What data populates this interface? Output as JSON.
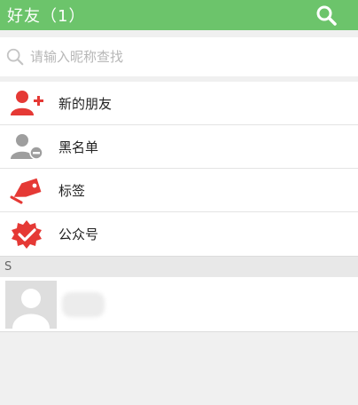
{
  "header": {
    "title": "好友（1）",
    "search_icon": "search-icon",
    "bg_color": "#6cc46b"
  },
  "search": {
    "placeholder": "请输入昵称查找",
    "icon": "search-icon"
  },
  "menu": {
    "items": [
      {
        "label": "新的朋友",
        "icon": "add-user-icon",
        "color": "#e53935"
      },
      {
        "label": "黑名单",
        "icon": "blocked-user-icon",
        "color": "#9e9e9e"
      },
      {
        "label": "标签",
        "icon": "tag-icon",
        "color": "#e53935"
      },
      {
        "label": "公众号",
        "icon": "verified-badge-icon",
        "color": "#e53935"
      }
    ]
  },
  "contacts": {
    "section_letter": "S",
    "items": [
      {
        "name": "",
        "avatar": "default-avatar-icon"
      }
    ]
  }
}
